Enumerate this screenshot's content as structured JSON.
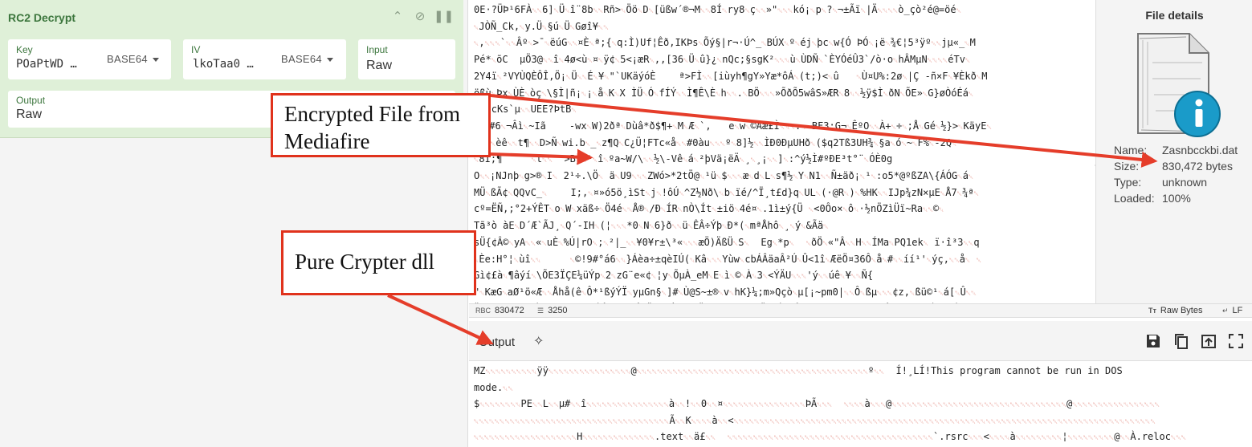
{
  "recipe": {
    "title": "RC2 Decrypt",
    "key": {
      "label": "Key",
      "value": "POaPtWD …",
      "format": "BASE64"
    },
    "iv": {
      "label": "IV",
      "value": "lkoTaa0 …",
      "format": "BASE64"
    },
    "input": {
      "label": "Input",
      "value": "Raw"
    },
    "output": {
      "label": "Output",
      "value": "Raw"
    }
  },
  "input_pane": {
    "lines": [
      "0E·?ÜÞ¹6FÀ••6]•Ü•î¨8b••Rñ>•Öö•D•[üßw´®¬M••8Í•ry8•ç••»\"•••kó¡•p•?•¬±Ãï•|Ä••••ò_çò²é@=öé•",
      "•JÒÑ_Ck,•y.Ü•§ú•Ü•Gøî¥••",
      "•,•••`••Âº•>¯•ëúG••¤È•ª;{•q:Ì)Uf¦Êð,IKÞs•Õý§|r¬·Ú^_•BÚX•º•éj•þc•w{Ó ÞÓ•¡ë•¾€¦5³ÿº••jµ«_•M",
      "Pé*•õC  µÖ3@••î•4ø<ù•¤•ÿ¢•5<¡æR•,,[36•Ü•û}¿•nQc;§sgK²•••ù•ÙDÑ•`ÈYÓéÛ3`/ò·o•hÂMµN••••éTv•",
      "2Y4ï•²VYÙQÈÔÎ,Ö¡•Ü••É•¥•\"`UKäýóÈ    ª>FÌ••[iùyh¶gY»Yæ*ôÁ•(t;)<•û   •Ù¤U%:2ø•|Ç -ñ×F•¥Èkð•M",
      "ößù•Þx•ÙÈ•òç•\\§Ì|ñ¡•¡•å•K•X ÌÜ•Ó•fÍÝ••Ì¶Ê\\È•h••.•BÖ•••»ÕðÕ5wâS»ÆR•8••½ÿ$Ì•ðN•ÕE»•G}øÒóÉá•",
      "©`bcKs`µ••UEE?ÞtB•",
      "•••#6•¬Âì•~Iã    -wx•W)2ðª•Dùâ*ð$¶+•M•Æ•`,   e•w•©Aæ£Ì•••.•~BF3:G¬•ÊºO••À+•÷•;Å•Gé•½}>•KäyE•",
      "•©è•èê••t¶••D>Ñ•wi.b•_•z¶Q•C¿Ü¦FTc«å••#0àu•••º•8]½••ÌÐ0ÐµUHð•($q2Tß3UH¾•§a•ó•~•F%•-2Q•",
      "•8Ì;¶     •t••  >By•¹•î•ºa~W/\\••½\\-Vê•á•²þVä¡ëÄ•¸•¸¡••]•:^ý½Ì#ºÐE³t°¨•ÓÈ0g",
      "O••¡NJnþ•g>®•I• 2¹÷.\\Ö• ä•U9•••ZWó>*2tÖ@•¹ü•$•••æ•d•L•s¶½•Y•N1••Ñ±äð¡•¹•:o5*@ºßZA\\{ÁÓG•á•",
      "MÜ•ßÃ¢•QQvC_•    I;,•¤»ó5ö¸ìSt•j•!ôÚ•^Z½Nð\\•b•ïé/^Ï¸t£d}q•UL•(·@R•)•%HK••IJp¾zN×µE•Å7•¾ª•",
      "cº=ËÑ,;°2+ÝÊT•o•W•xäß÷•Ö4é••Å®•/Ð•ÍR•nÒ\\Ít•±iö•4é¤•.1ì±ý{Ü •<0Ôo×•ô•·½nÖZìÜï~Ra••©•",
      "Tã³ò àE•D´Æ`ÃJ¸•Q´-IH•(¦•••*0•N•6}ð••ü•ÊÂ÷Ýþ•Ð*(•mªÅhô•¸•ý•&Ãä•",
      "sÜ{¢Â©•yA••«•uÈ•%Ú|rO•;•²|_••¥0¥r±\\³«•••æÖ)ÄßÜ•S•  Eg•*p•  •ðÖ•«\"Â••H••ÍMa•PQ1ek• ï·î³3••q",
      "•Èe:H°¦•ùî••     •©!9#°á6••}Áèa÷±qèIÚ(•Kâ•••Yùw•cbÁÂäaÂ²Ú•Û<1î•ÆëÖ¤36Ô•å•#••íí¹'•ýç,••å• •",
      "Gì¢£à•¶âýí•\\ÕE3ÏÇE¼üÝp•2•zG¨e«¢•¦y•ÕµÀ_eM•E•ì•©•À•3•<ÝÄU•••'ý••úê•¥••Ñ{",
      "\"•KæG•aØ¹ö«Æ••Åhå(ê•Ô*¹ßýÝÏ•yµGn§•]#•Ù@S~±®•v•hK}¼;m»Qçò•µ[¡~pm0|••Ô•ßµ•••¢z,•ßü©¹•á[•Û••",
      "Ü?M••ò7é••DÀ•••7Y£%º••ÌÎ••5ydÚVÜ¯MüÓT²H•ËcV••2•(×¹1Ë• ÉuýÅ•å0}M• O[üê•<•JÊéwbª•3ªÌ2•UÍ•¬•Ø•"
    ]
  },
  "file_details": {
    "title": "File details",
    "name_label": "Name:",
    "name": "Zasnbcckbi.dat",
    "size_label": "Size:",
    "size": "830,472 bytes",
    "type_label": "Type:",
    "type": "unknown",
    "loaded_label": "Loaded:",
    "loaded": "100%"
  },
  "input_status": {
    "length_icon": "RBC",
    "length": "830472",
    "lines_icon": "lines-icon",
    "lines": "3250",
    "encoding": "Raw Bytes",
    "eol": "LF"
  },
  "output_pane": {
    "title": "Output",
    "lines": [
      "MZ••••••••••ÿÿ••••••••••••••••@•••••••••••••••••••••••••••••••••••••••••••••º••  Í!¸LÍ!This program cannot be run in DOS",
      "mode.••",
      "$••••••••PE••L••µ#••î••••••••••••••••à••!••0••¤••••••••••••••••ÞÃ•••  ••••à•••@••••••••••••••••••••••••••••••••••@•••••••••••••••••",
      "••••••••••••••••••••••••••••••••••••••Ã••K••••à••<••••••••••••••••••••••••••••••••••••••••••••••••••••••••••••••••••••••••••••••••••",
      "••••••••••••••••••••H••••••••••••••.text••ä£••  ••••••••••••••••••••••••••••••••••••••••`.rsrc•••<••••à•••••••••¦•••••••••@••À.reloc•••",
      "•••••••••••••••••••••••••••••••••••••••••••••••••••••••••••••••••••••••••••••••••••••••••••••••••••••••••••••••••••••••••••••••••••"
    ]
  },
  "annotations": {
    "encrypted": "Encrypted File from Mediafire",
    "pure_crypter": "Pure Crypter dll"
  },
  "colors": {
    "recipe_green": "#dff0d8",
    "recipe_text_green": "#3c763d",
    "annotation_red": "#e0321c",
    "nonprint_red": "#e07a6e"
  }
}
